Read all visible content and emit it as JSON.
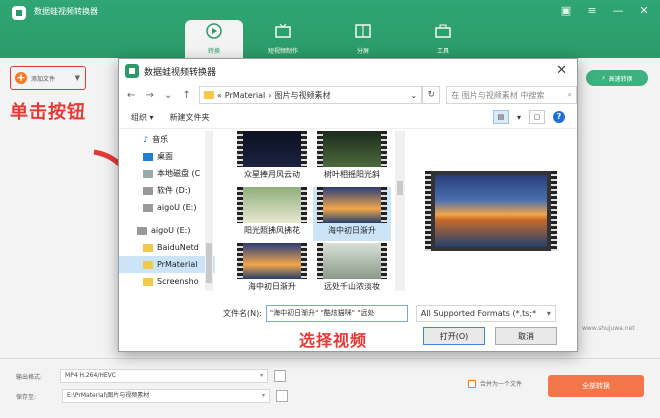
{
  "app": {
    "title": "数据蛙视频转换器",
    "tabs": [
      {
        "label": "转换",
        "icon": "convert-icon"
      },
      {
        "label": "短视频制作",
        "icon": "tv-icon"
      },
      {
        "label": "分屏",
        "icon": "split-screen-icon"
      },
      {
        "label": "工具",
        "icon": "toolbox-icon"
      }
    ],
    "add_file_label": "添加文件",
    "high_speed_label": "高速转换",
    "annotation_click": "单击按钮",
    "annotation_select": "选择视频",
    "watermark": "www.shujuwa.net",
    "colors": {
      "brand_green": "#2b9a69",
      "accent_orange": "#f2764a",
      "annotation_red": "#e53935"
    }
  },
  "bottom": {
    "output_format_label": "输出格式:",
    "output_format_value": "MP4 H.264/HEVC",
    "save_to_label": "保存至:",
    "save_to_value": "E:\\PrMaterial\\图片与视频素材",
    "merge_label": "合并为一个文件",
    "convert_all_label": "全部转换"
  },
  "dialog": {
    "title": "数据蛙视频转换器",
    "address": [
      "PrMaterial",
      "图片与视频素材"
    ],
    "search_placeholder": "在 图片与视频素材 中搜索",
    "organize_label": "组织",
    "new_folder_label": "新建文件夹",
    "sidebar": [
      {
        "label": "音乐",
        "icon": "music-icon"
      },
      {
        "label": "桌面",
        "icon": "desktop-icon"
      },
      {
        "label": "本地磁盘 (C",
        "icon": "drive-icon"
      },
      {
        "label": "软件 (D:)",
        "icon": "drive-icon"
      },
      {
        "label": "aigoU (E:)",
        "icon": "drive-icon"
      },
      {
        "label": "aigoU (E:)",
        "icon": "drive-icon"
      },
      {
        "label": "BaiduNetd",
        "icon": "folder-icon"
      },
      {
        "label": "PrMaterial",
        "icon": "folder-icon"
      },
      {
        "label": "Screensho",
        "icon": "folder-icon"
      }
    ],
    "files": [
      {
        "name": "众星捧月风云动"
      },
      {
        "name": "树叶相摇阳光斜"
      },
      {
        "name": "阳光照拂风拂花"
      },
      {
        "name": "海中初日渐升"
      },
      {
        "name": "海中初日渐升"
      },
      {
        "name": "远处千山浓淡妆"
      }
    ],
    "filename_label": "文件名(N):",
    "filename_value": "\"海中初日渐升\" \"酷炫猫咪\" \"远处",
    "filetype_value": "All Supported Formats (*.ts;*",
    "open_label": "打开(O)",
    "cancel_label": "取消"
  }
}
